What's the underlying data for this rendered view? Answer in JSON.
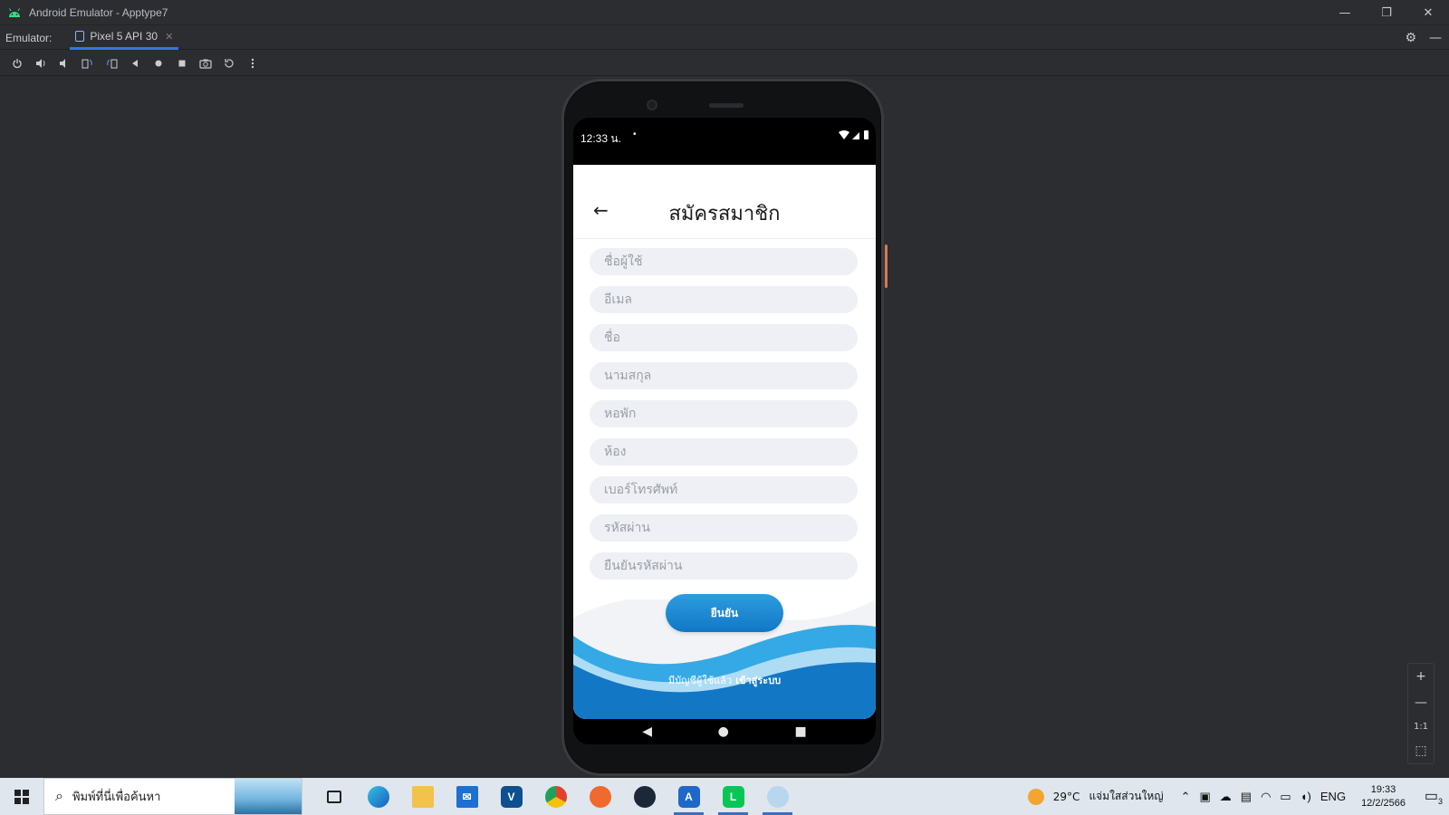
{
  "window": {
    "title": "Android Emulator - Apptype7",
    "minimize": "—",
    "restore": "❐",
    "close": "✕"
  },
  "tabbar": {
    "label": "Emulator:",
    "active_tab": "Pixel 5 API 30",
    "close": "✕",
    "settings_icon": "⚙",
    "hide_icon": "—"
  },
  "toolbar": {
    "buttons": [
      "power-icon",
      "volume-up-icon",
      "volume-down-icon",
      "rotate-left-icon",
      "rotate-right-icon",
      "back-icon",
      "home-icon",
      "overview-icon",
      "screenshot-icon",
      "snapshot-icon",
      "more-icon"
    ]
  },
  "device": {
    "status": {
      "time": "12:33 น.",
      "dot": "•",
      "sys": "▾◢▮"
    },
    "app": {
      "title": "สมัครสมาชิก",
      "back": "←",
      "fields": [
        {
          "placeholder": "ชื่อผู้ใช้"
        },
        {
          "placeholder": "อีเมล"
        },
        {
          "placeholder": "ชื่อ"
        },
        {
          "placeholder": "นามสกุล"
        },
        {
          "placeholder": "หอพัก"
        },
        {
          "placeholder": "ห้อง"
        },
        {
          "placeholder": "เบอร์โทรศัพท์"
        },
        {
          "placeholder": "รหัสผ่าน"
        },
        {
          "placeholder": "ยืนยันรหัสผ่าน"
        }
      ],
      "confirm_button": "ยืนยัน",
      "login_prompt": "มีบัญชีผู้ใช้แล้ว",
      "login_link": "เข้าสู่ระบบ"
    },
    "nav": {
      "back": "◀",
      "home": "●",
      "overview": "■"
    }
  },
  "zoom": {
    "plus": "+",
    "minus": "—",
    "one_to_one": "1:1",
    "fit": "⬚"
  },
  "taskbar": {
    "search_placeholder": "พิมพ์ที่นี่เพื่อค้นหา",
    "weather_temp": "29°C",
    "weather_text": "แจ่มใสส่วนใหญ่",
    "lang": "ENG",
    "time": "19:33",
    "date": "12/2/2566",
    "notification_count": "3"
  },
  "colors": {
    "accent": "#1a84cf",
    "wave_dark": "#1277c4",
    "wave_light": "#35a9e6"
  }
}
